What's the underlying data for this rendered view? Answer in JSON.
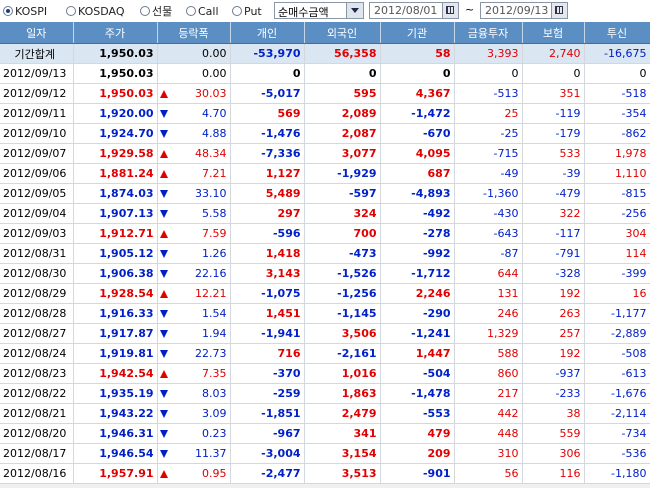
{
  "toolbar": {
    "radios": [
      {
        "label": "KOSPI",
        "selected": true
      },
      {
        "label": "KOSDAQ",
        "selected": false
      },
      {
        "label": "선물",
        "selected": false
      },
      {
        "label": "Call",
        "selected": false
      },
      {
        "label": "Put",
        "selected": false
      }
    ],
    "combo_value": "순매수금액",
    "date_from": "2012/08/01",
    "tilde": "~",
    "date_to": "2012/09/13"
  },
  "colors": {
    "up": "#e10000",
    "down": "#0020c8",
    "header_bg": "#5b8fc4",
    "summary_bg": "#dbe6f3"
  },
  "table": {
    "headers": [
      "일자",
      "주가",
      "등락폭",
      "개인",
      "외국인",
      "기관",
      "금융투자",
      "보험",
      "투신"
    ],
    "summary": {
      "date": "기간합계",
      "price": "1,950.03",
      "change": "0.00",
      "dir": "none",
      "indiv": "-53,970",
      "foreign": "56,358",
      "inst": "58",
      "fin": "3,393",
      "ins": "2,740",
      "trust": "-16,675"
    },
    "rows": [
      {
        "date": "2012/09/13",
        "price": "1,950.03",
        "change": "0.00",
        "dir": "none",
        "indiv": "0",
        "foreign": "0",
        "inst": "0",
        "fin": "0",
        "ins": "0",
        "trust": "0"
      },
      {
        "date": "2012/09/12",
        "price": "1,950.03",
        "change": "30.03",
        "dir": "up",
        "indiv": "-5,017",
        "foreign": "595",
        "inst": "4,367",
        "fin": "-513",
        "ins": "351",
        "trust": "-518"
      },
      {
        "date": "2012/09/11",
        "price": "1,920.00",
        "change": "4.70",
        "dir": "down",
        "indiv": "569",
        "foreign": "2,089",
        "inst": "-1,472",
        "fin": "25",
        "ins": "-119",
        "trust": "-354"
      },
      {
        "date": "2012/09/10",
        "price": "1,924.70",
        "change": "4.88",
        "dir": "down",
        "indiv": "-1,476",
        "foreign": "2,087",
        "inst": "-670",
        "fin": "-25",
        "ins": "-179",
        "trust": "-862"
      },
      {
        "date": "2012/09/07",
        "price": "1,929.58",
        "change": "48.34",
        "dir": "up",
        "indiv": "-7,336",
        "foreign": "3,077",
        "inst": "4,095",
        "fin": "-715",
        "ins": "533",
        "trust": "1,978"
      },
      {
        "date": "2012/09/06",
        "price": "1,881.24",
        "change": "7.21",
        "dir": "up",
        "indiv": "1,127",
        "foreign": "-1,929",
        "inst": "687",
        "fin": "-49",
        "ins": "-39",
        "trust": "1,110"
      },
      {
        "date": "2012/09/05",
        "price": "1,874.03",
        "change": "33.10",
        "dir": "down",
        "indiv": "5,489",
        "foreign": "-597",
        "inst": "-4,893",
        "fin": "-1,360",
        "ins": "-479",
        "trust": "-815"
      },
      {
        "date": "2012/09/04",
        "price": "1,907.13",
        "change": "5.58",
        "dir": "down",
        "indiv": "297",
        "foreign": "324",
        "inst": "-492",
        "fin": "-430",
        "ins": "322",
        "trust": "-256"
      },
      {
        "date": "2012/09/03",
        "price": "1,912.71",
        "change": "7.59",
        "dir": "up",
        "indiv": "-596",
        "foreign": "700",
        "inst": "-278",
        "fin": "-643",
        "ins": "-117",
        "trust": "304"
      },
      {
        "date": "2012/08/31",
        "price": "1,905.12",
        "change": "1.26",
        "dir": "down",
        "indiv": "1,418",
        "foreign": "-473",
        "inst": "-992",
        "fin": "-87",
        "ins": "-791",
        "trust": "114"
      },
      {
        "date": "2012/08/30",
        "price": "1,906.38",
        "change": "22.16",
        "dir": "down",
        "indiv": "3,143",
        "foreign": "-1,526",
        "inst": "-1,712",
        "fin": "644",
        "ins": "-328",
        "trust": "-399"
      },
      {
        "date": "2012/08/29",
        "price": "1,928.54",
        "change": "12.21",
        "dir": "up",
        "indiv": "-1,075",
        "foreign": "-1,256",
        "inst": "2,246",
        "fin": "131",
        "ins": "192",
        "trust": "16"
      },
      {
        "date": "2012/08/28",
        "price": "1,916.33",
        "change": "1.54",
        "dir": "down",
        "indiv": "1,451",
        "foreign": "-1,145",
        "inst": "-290",
        "fin": "246",
        "ins": "263",
        "trust": "-1,177"
      },
      {
        "date": "2012/08/27",
        "price": "1,917.87",
        "change": "1.94",
        "dir": "down",
        "indiv": "-1,941",
        "foreign": "3,506",
        "inst": "-1,241",
        "fin": "1,329",
        "ins": "257",
        "trust": "-2,889"
      },
      {
        "date": "2012/08/24",
        "price": "1,919.81",
        "change": "22.73",
        "dir": "down",
        "indiv": "716",
        "foreign": "-2,161",
        "inst": "1,447",
        "fin": "588",
        "ins": "192",
        "trust": "-508"
      },
      {
        "date": "2012/08/23",
        "price": "1,942.54",
        "change": "7.35",
        "dir": "up",
        "indiv": "-370",
        "foreign": "1,016",
        "inst": "-504",
        "fin": "860",
        "ins": "-937",
        "trust": "-613"
      },
      {
        "date": "2012/08/22",
        "price": "1,935.19",
        "change": "8.03",
        "dir": "down",
        "indiv": "-259",
        "foreign": "1,863",
        "inst": "-1,478",
        "fin": "217",
        "ins": "-233",
        "trust": "-1,676"
      },
      {
        "date": "2012/08/21",
        "price": "1,943.22",
        "change": "3.09",
        "dir": "down",
        "indiv": "-1,851",
        "foreign": "2,479",
        "inst": "-553",
        "fin": "442",
        "ins": "38",
        "trust": "-2,114"
      },
      {
        "date": "2012/08/20",
        "price": "1,946.31",
        "change": "0.23",
        "dir": "down",
        "indiv": "-967",
        "foreign": "341",
        "inst": "479",
        "fin": "448",
        "ins": "559",
        "trust": "-734"
      },
      {
        "date": "2012/08/17",
        "price": "1,946.54",
        "change": "11.37",
        "dir": "down",
        "indiv": "-3,004",
        "foreign": "3,154",
        "inst": "209",
        "fin": "310",
        "ins": "306",
        "trust": "-536"
      },
      {
        "date": "2012/08/16",
        "price": "1,957.91",
        "change": "0.95",
        "dir": "up",
        "indiv": "-2,477",
        "foreign": "3,513",
        "inst": "-901",
        "fin": "56",
        "ins": "116",
        "trust": "-1,180"
      }
    ]
  }
}
